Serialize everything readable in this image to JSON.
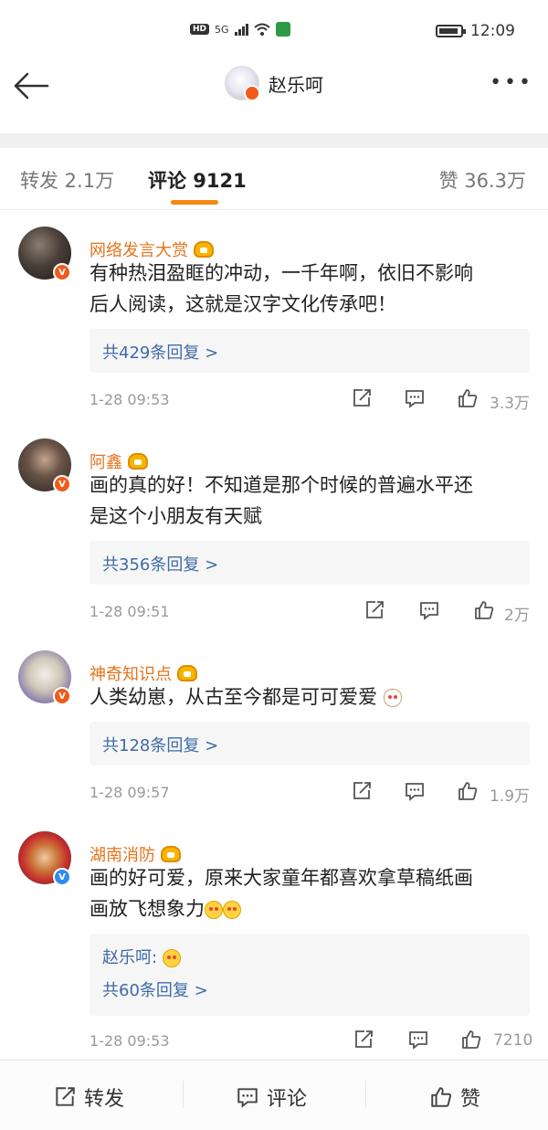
{
  "status_bar": {
    "hd": "HD",
    "network": "5G",
    "time": "12:09"
  },
  "nav": {
    "title": "赵乐呵",
    "back_icon": "arrow-left-icon",
    "more": "•••"
  },
  "tabs": {
    "repost": "转发 2.1万",
    "comments": "评论 9121",
    "likes": "赞 36.3万",
    "active": "comments"
  },
  "comments": [
    {
      "name": "网络发言大赏",
      "text_lines": [
        "有种热泪盈眶的冲动，一千年啊，依旧不影响",
        "后人阅读，这就是汉字文化传承吧！"
      ],
      "replies": "共429条回复 >",
      "time": "1-28 09:53",
      "likes": "3.3万",
      "badge": "V"
    },
    {
      "name": "阿鑫",
      "text_lines": [
        "画的真的好！不知道是那个时候的普遍水平还",
        "是这个小朋友有天赋"
      ],
      "replies": "共356条回复 >",
      "time": "1-28 09:51",
      "likes": "2万",
      "badge": "V"
    },
    {
      "name": "神奇知识点",
      "text_lines": [
        "人类幼崽，从古至今都是可可爱爱"
      ],
      "replies": "共128条回复 >",
      "time": "1-28 09:57",
      "likes": "1.9万",
      "badge": "V"
    },
    {
      "name": "湖南消防",
      "text_lines": [
        "画的好可爱，原来大家童年都喜欢拿草稿纸画",
        "画放飞想象力"
      ],
      "reply_author": "赵乐呵:",
      "replies": "共60条回复 >",
      "time": "1-28 09:53",
      "likes": "7210",
      "badge": "V"
    }
  ],
  "bottom_bar": {
    "repost": "转发",
    "comment": "评论",
    "like": "赞"
  },
  "colors": {
    "accent_orange": "#f28a12",
    "name_orange": "#e5731c",
    "link_blue": "#3e6aa8",
    "verify_orange": "#f05a1a",
    "verify_blue": "#2f8cf0"
  }
}
